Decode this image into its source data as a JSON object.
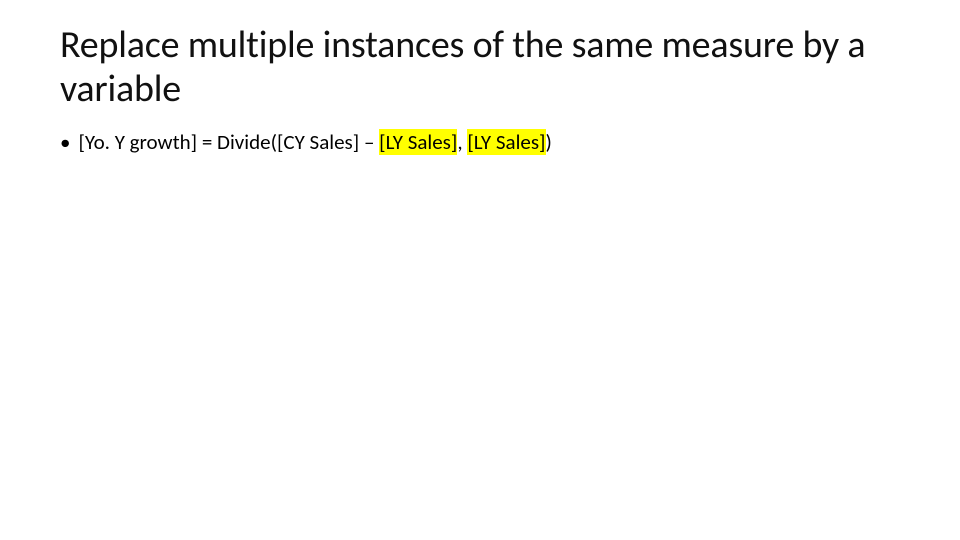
{
  "title": "Replace multiple instances of the same measure by a variable",
  "bullet": {
    "dot": "•",
    "seg_prefix": "[Yo. Y growth] = Divide([CY Sales] – ",
    "seg_hl1": "[LY Sales]",
    "seg_mid": ", ",
    "seg_hl2": "[LY Sales]",
    "seg_suffix": ")"
  }
}
